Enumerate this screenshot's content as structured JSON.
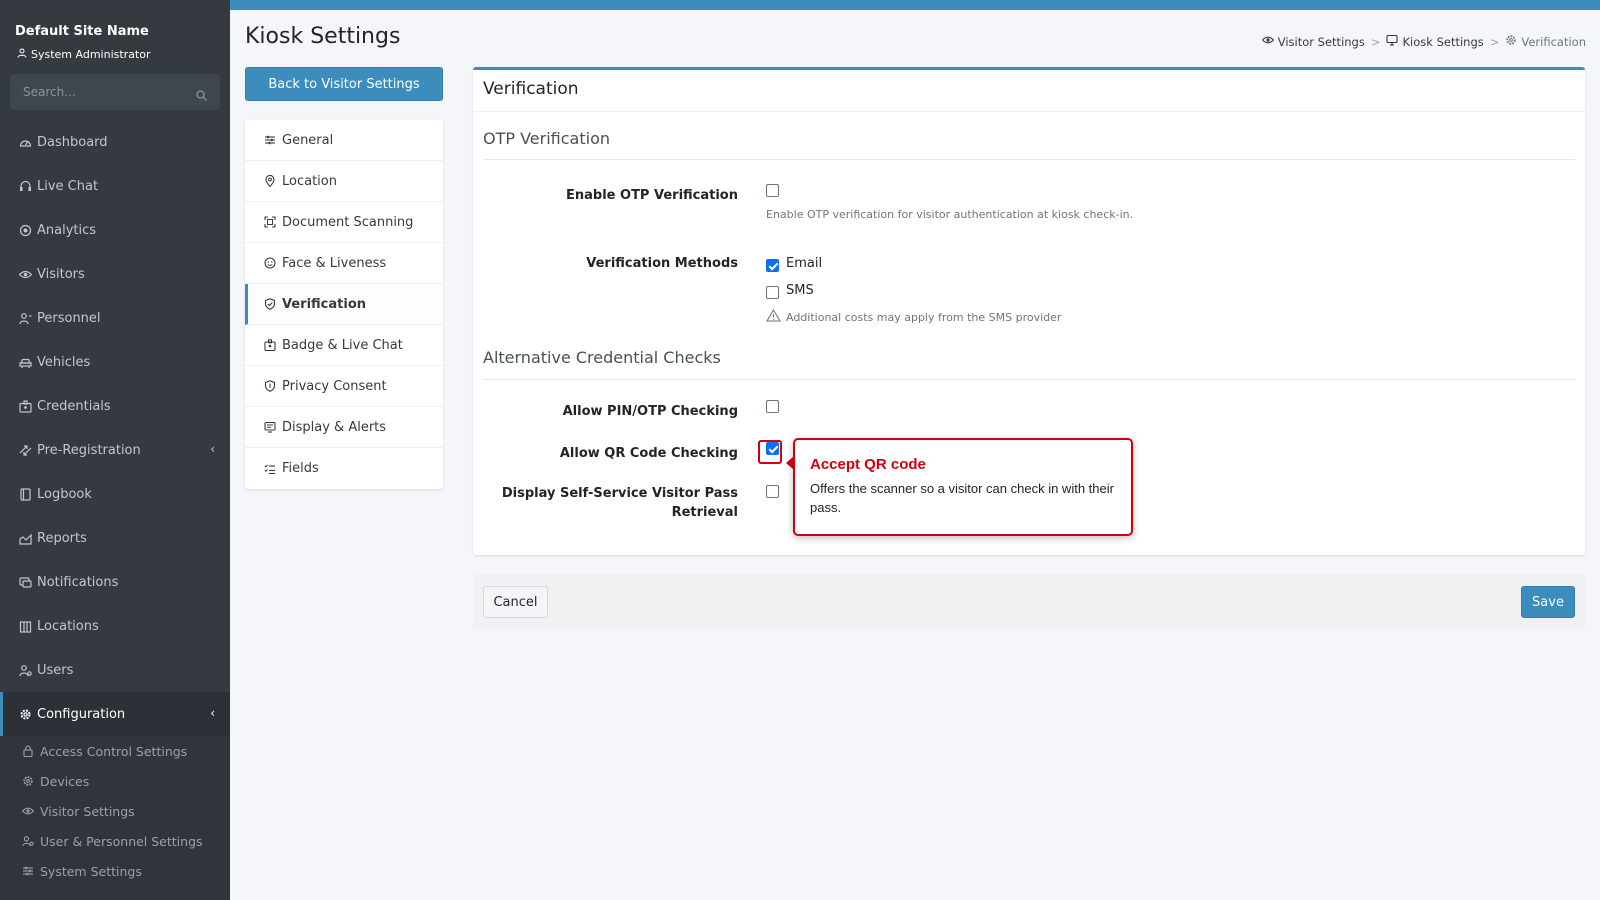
{
  "sidebar": {
    "site_name": "Default Site Name",
    "user_role": "System Administrator",
    "search_placeholder": "Search...",
    "items": [
      {
        "label": "Dashboard",
        "icon": "dashboard-icon"
      },
      {
        "label": "Live Chat",
        "icon": "headset-icon"
      },
      {
        "label": "Analytics",
        "icon": "analytics-icon"
      },
      {
        "label": "Visitors",
        "icon": "eye-icon"
      },
      {
        "label": "Personnel",
        "icon": "person-icon"
      },
      {
        "label": "Vehicles",
        "icon": "car-icon"
      },
      {
        "label": "Credentials",
        "icon": "badge-icon"
      },
      {
        "label": "Pre-Registration",
        "icon": "arrows-icon",
        "chevron": "‹"
      },
      {
        "label": "Logbook",
        "icon": "book-icon"
      },
      {
        "label": "Reports",
        "icon": "report-icon"
      },
      {
        "label": "Notifications",
        "icon": "bell-icon"
      },
      {
        "label": "Locations",
        "icon": "building-icon"
      },
      {
        "label": "Users",
        "icon": "users-icon"
      },
      {
        "label": "Configuration",
        "icon": "gear-icon",
        "chevron": "‹",
        "active": true
      }
    ],
    "subitems": [
      {
        "label": "Access Control Settings",
        "icon": "lock-icon"
      },
      {
        "label": "Devices",
        "icon": "gear-icon"
      },
      {
        "label": "Visitor Settings",
        "icon": "eye-icon"
      },
      {
        "label": "User & Personnel Settings",
        "icon": "users-icon"
      },
      {
        "label": "System Settings",
        "icon": "sliders-icon"
      }
    ]
  },
  "header": {
    "title": "Kiosk Settings",
    "breadcrumb": [
      "Visitor Settings",
      "Kiosk Settings",
      "Verification"
    ],
    "breadcrumb_sep": ">"
  },
  "back_button": "Back to Visitor Settings",
  "settings_nav": [
    {
      "label": "General",
      "icon": "sliders-icon"
    },
    {
      "label": "Location",
      "icon": "pin-icon"
    },
    {
      "label": "Document Scanning",
      "icon": "scan-icon"
    },
    {
      "label": "Face & Liveness",
      "icon": "face-icon"
    },
    {
      "label": "Verification",
      "icon": "shield-check-icon",
      "active": true
    },
    {
      "label": "Badge & Live Chat",
      "icon": "badge-icon"
    },
    {
      "label": "Privacy Consent",
      "icon": "shield-icon"
    },
    {
      "label": "Display & Alerts",
      "icon": "display-icon"
    },
    {
      "label": "Fields",
      "icon": "list-check-icon"
    }
  ],
  "card": {
    "title": "Verification",
    "otp": {
      "section_title": "OTP Verification",
      "enable_label": "Enable OTP Verification",
      "enable_checked": false,
      "enable_help": "Enable OTP verification for visitor authentication at kiosk check-in.",
      "methods_label": "Verification Methods",
      "method_email": "Email",
      "method_email_checked": true,
      "method_sms": "SMS",
      "method_sms_checked": false,
      "sms_warning": "Additional costs may apply from the SMS provider"
    },
    "alt": {
      "section_title": "Alternative Credential Checks",
      "pin_label": "Allow PIN/OTP Checking",
      "pin_checked": false,
      "qr_label": "Allow QR Code Checking",
      "qr_checked": true,
      "selfservice_label_line1": "Display Self-Service Visitor Pass",
      "selfservice_label_line2": "Retrieval",
      "selfservice_checked": false
    }
  },
  "callout": {
    "title": "Accept QR code",
    "body": "Offers the scanner so a visitor can check in with their pass."
  },
  "footer": {
    "cancel": "Cancel",
    "save": "Save"
  },
  "colors": {
    "accent": "#3c8dbc",
    "sidebar_bg": "#343a40",
    "highlight_red": "#d00010",
    "checkbox_blue": "#0d6efd"
  }
}
